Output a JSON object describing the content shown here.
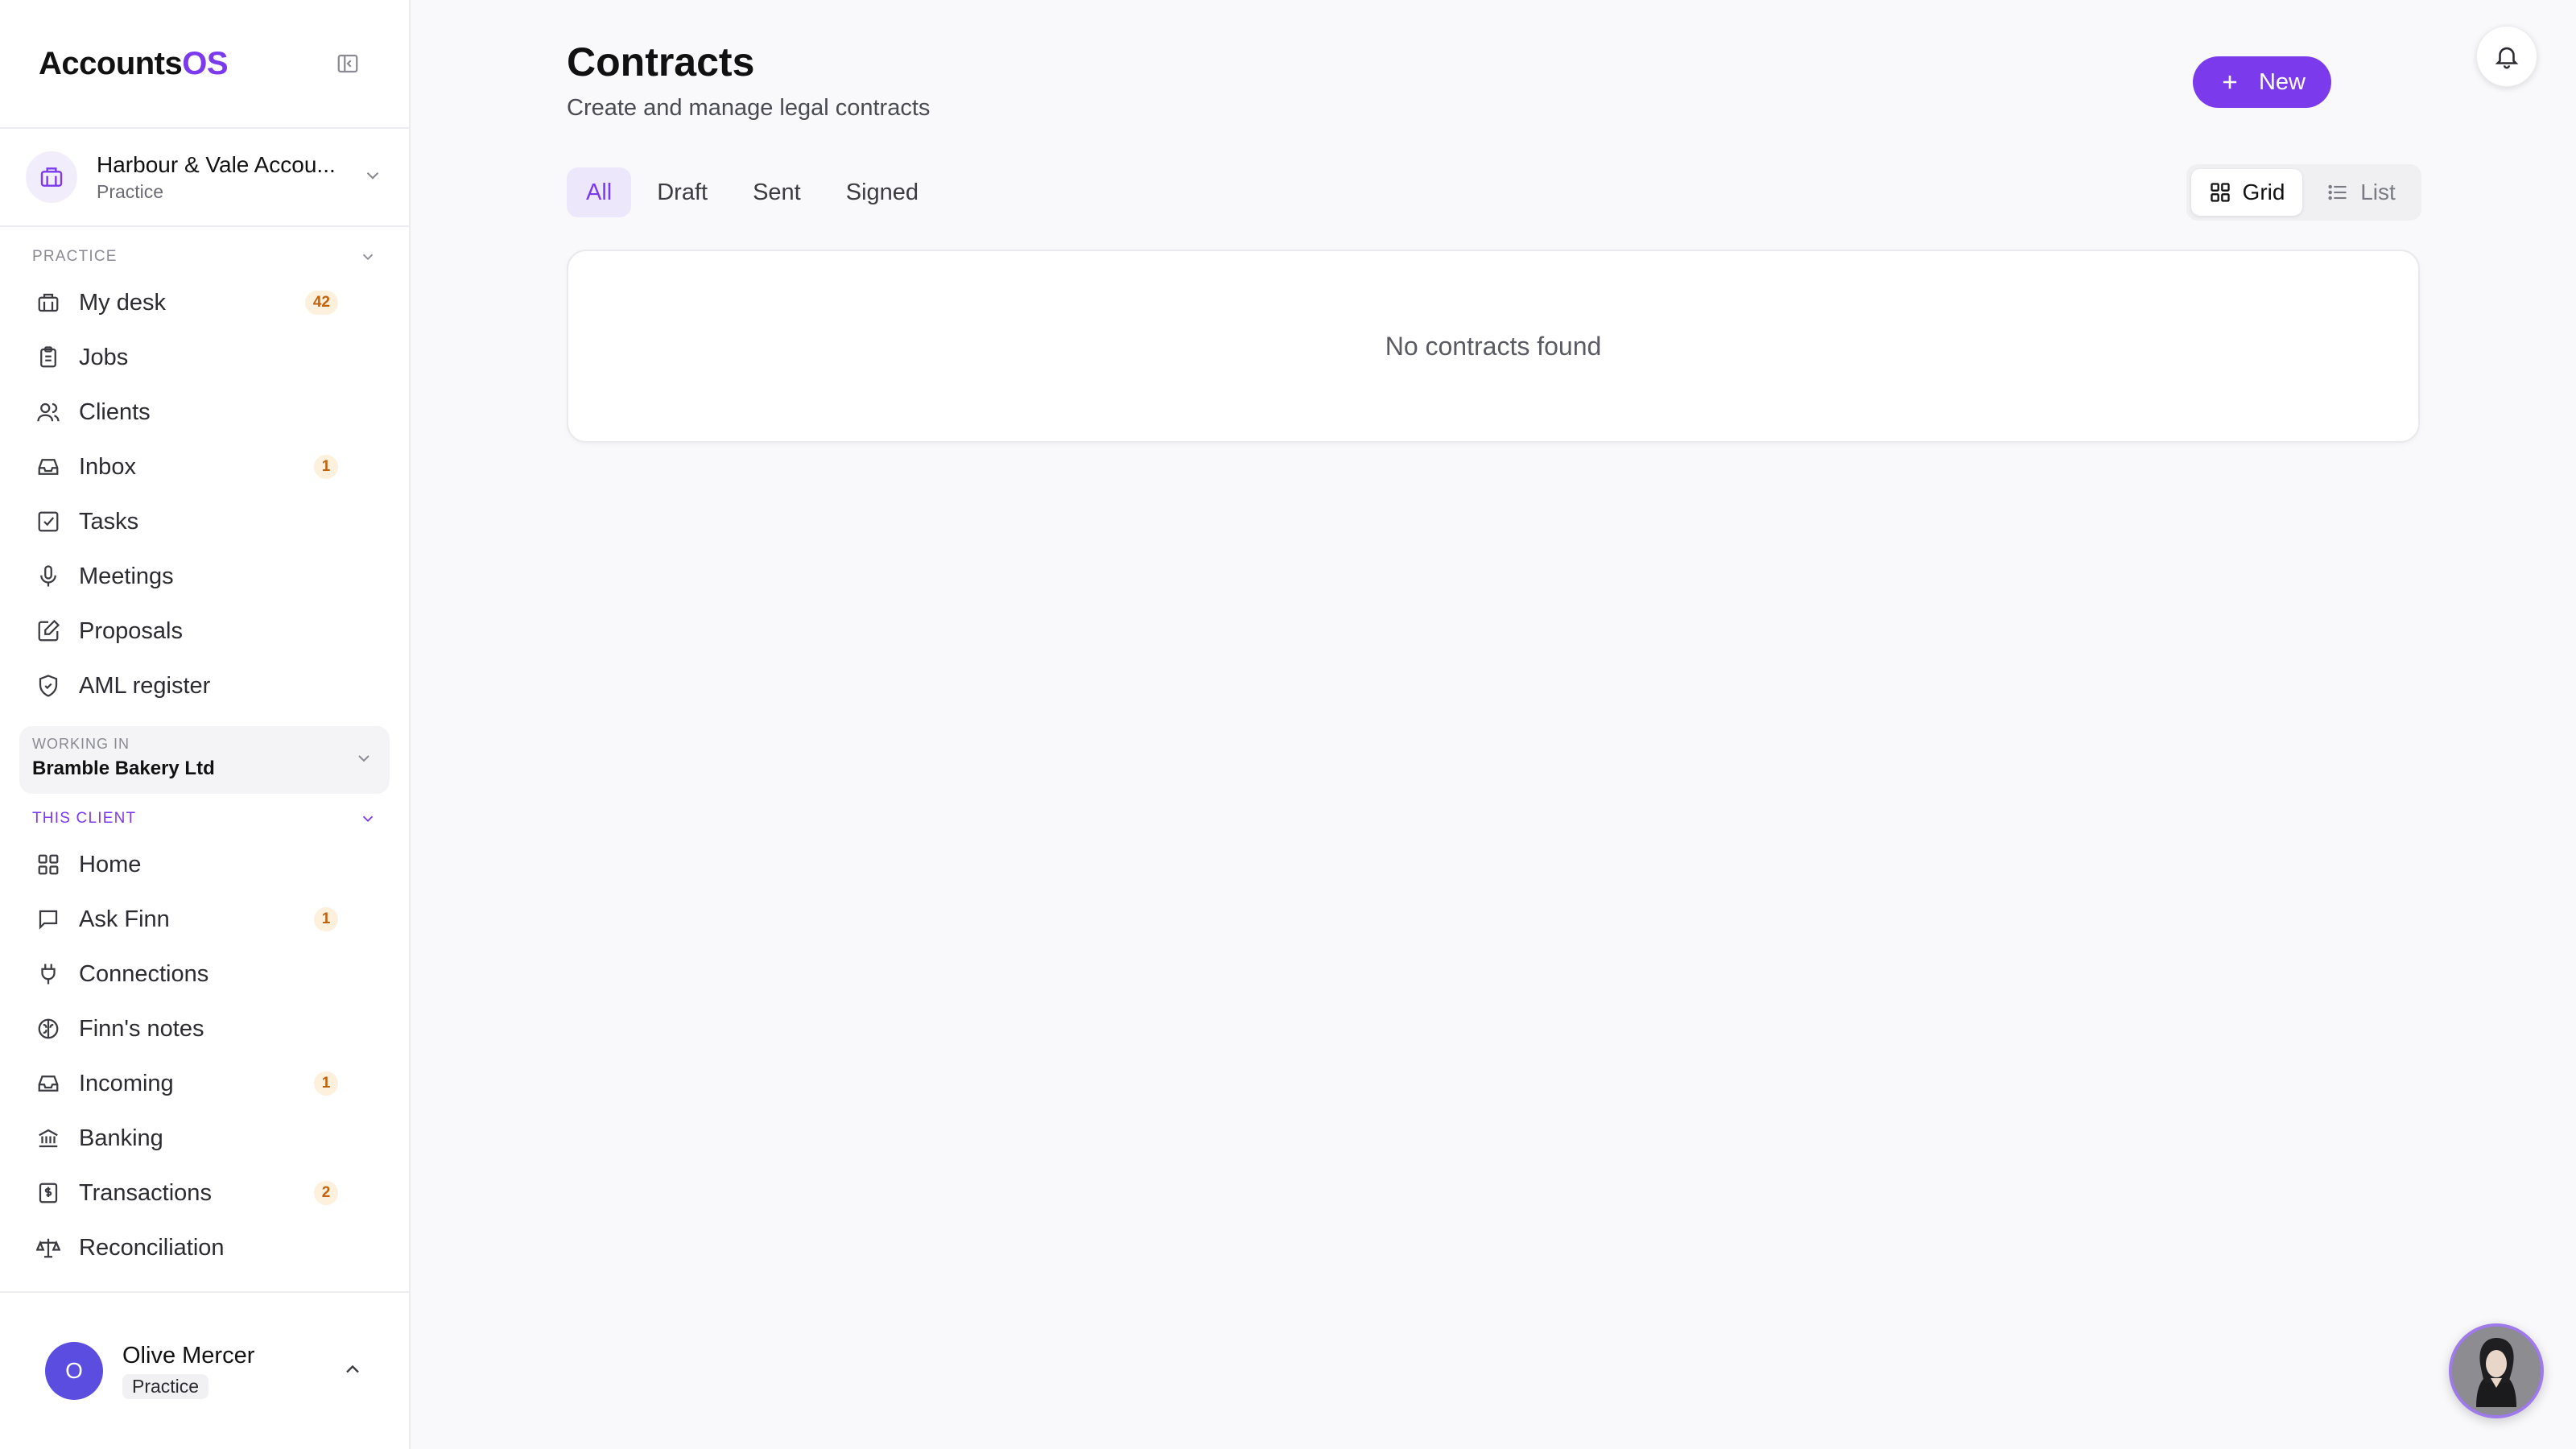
{
  "brand": {
    "name": "Accounts",
    "suffix": "OS"
  },
  "org": {
    "name": "Harbour & Vale Accou...",
    "type": "Practice"
  },
  "sidebar": {
    "practice_section": {
      "title": "PRACTICE"
    },
    "practice_items": [
      {
        "label": "My desk",
        "icon": "briefcase-icon",
        "badge": "42"
      },
      {
        "label": "Jobs",
        "icon": "clipboard-icon",
        "badge": null
      },
      {
        "label": "Clients",
        "icon": "users-icon",
        "badge": null
      },
      {
        "label": "Inbox",
        "icon": "inbox-icon",
        "badge": "1"
      },
      {
        "label": "Tasks",
        "icon": "check-square-icon",
        "badge": null
      },
      {
        "label": "Meetings",
        "icon": "microphone-icon",
        "badge": null
      },
      {
        "label": "Proposals",
        "icon": "pen-square-icon",
        "badge": null
      },
      {
        "label": "AML register",
        "icon": "shield-check-icon",
        "badge": null
      }
    ],
    "working_in": {
      "label": "WORKING IN",
      "value": "Bramble Bakery Ltd"
    },
    "client_section": {
      "title": "THIS CLIENT"
    },
    "client_items": [
      {
        "label": "Home",
        "icon": "grid-icon",
        "badge": null
      },
      {
        "label": "Ask Finn",
        "icon": "message-icon",
        "badge": "1"
      },
      {
        "label": "Connections",
        "icon": "plug-icon",
        "badge": null
      },
      {
        "label": "Finn's notes",
        "icon": "brain-icon",
        "badge": null
      },
      {
        "label": "Incoming",
        "icon": "inbox-icon",
        "badge": "1"
      },
      {
        "label": "Banking",
        "icon": "bank-icon",
        "badge": null
      },
      {
        "label": "Transactions",
        "icon": "receipt-dollar-icon",
        "badge": "2"
      },
      {
        "label": "Reconciliation",
        "icon": "scale-icon",
        "badge": null
      }
    ]
  },
  "user": {
    "initial": "O",
    "name": "Olive Mercer",
    "role": "Practice"
  },
  "page": {
    "title": "Contracts",
    "subtitle": "Create and manage legal contracts",
    "new_button": "New",
    "tabs": [
      "All",
      "Draft",
      "Sent",
      "Signed"
    ],
    "active_tab": "All",
    "view_toggle": {
      "grid": "Grid",
      "list": "List",
      "active": "grid"
    },
    "empty_message": "No contracts found"
  },
  "colors": {
    "accent": "#7c3aed",
    "badge_bg": "#fdf0dc",
    "badge_text": "#c2620c"
  }
}
